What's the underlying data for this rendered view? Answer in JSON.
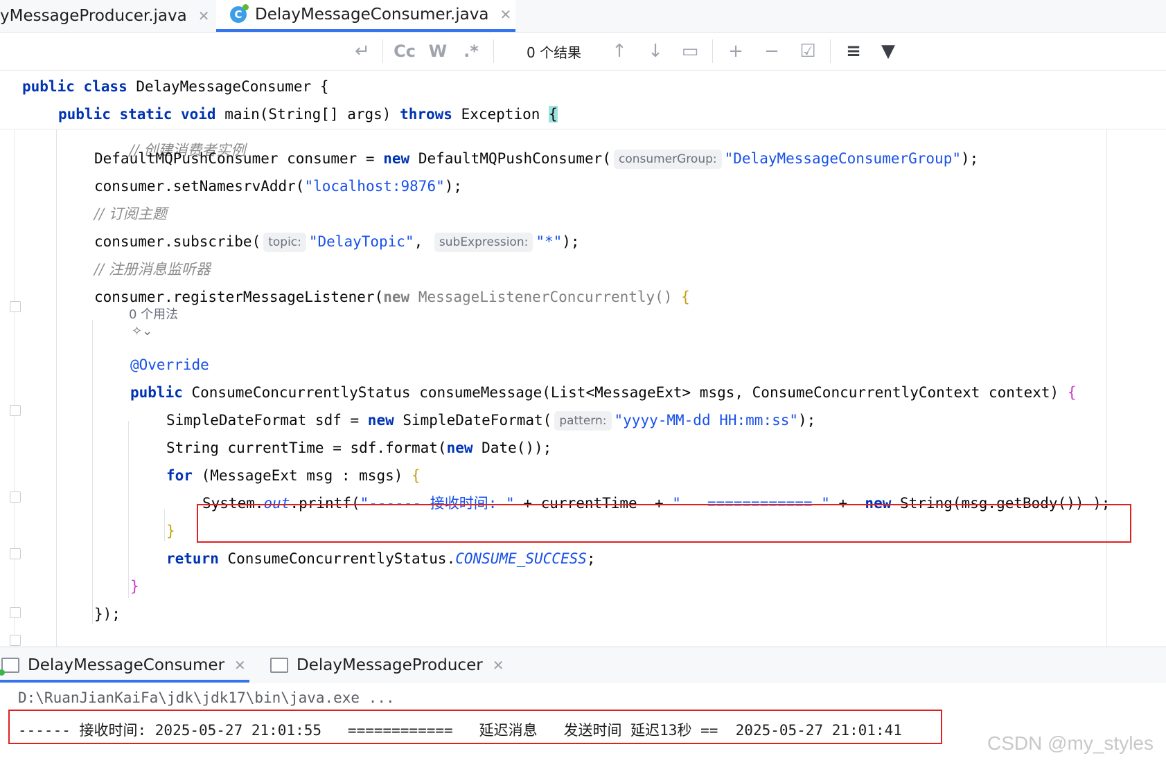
{
  "tabs": [
    {
      "label": "yMessageProducer.java"
    },
    {
      "label": "DelayMessageConsumer.java"
    }
  ],
  "find_toolbar": {
    "replace_icon": "↵",
    "match_case": "Cc",
    "words": "W",
    "regex": ".*",
    "result": "0 个结果",
    "prev_icon": "↑",
    "next_icon": "↓",
    "select_all_icon": "▭",
    "add_occurrence_icon": "+",
    "remove_occurrence_icon": "−",
    "select_occurrences_icon": "☑",
    "filter_options_icon": "≡",
    "filter_icon": "▼"
  },
  "code": {
    "l1_kw": "public class",
    "l1_name": " DelayMessageConsumer ",
    "l1_brace": "{",
    "l2_kw1": "public static void",
    "l2_a": " main(String[] args) ",
    "l2_kw2": "throws",
    "l2_b": " Exception ",
    "l2_brace": "{",
    "l3_comment": "// 创建消费者实例",
    "l4_a": "DefaultMQPushConsumer consumer = ",
    "l4_new": "new",
    "l4_b": " DefaultMQPushConsumer(",
    "l4_hint": "consumerGroup:",
    "l4_str": "\"DelayMessageConsumerGroup\"",
    "l4_end": ");",
    "l5_a": "consumer.setNamesrvAddr(",
    "l5_str": "\"localhost:9876\"",
    "l5_end": ");",
    "l6_comment": "// 订阅主题",
    "l7_a": "consumer.subscribe(",
    "l7_hint1": "topic:",
    "l7_str1": "\"DelayTopic\"",
    "l7_comma": ", ",
    "l7_hint2": "subExpression:",
    "l7_str2": "\"*\"",
    "l7_end": ");",
    "l8_comment": "// 注册消息监听器",
    "l9_a": "consumer.registerMessageListener(",
    "l9_new": "new",
    "l9_b": " MessageListenerConcurrently() ",
    "l9_brace": "{",
    "usage": "0 个用法",
    "override": "@Override",
    "l11_kw": "public",
    "l11_a": " ConsumeConcurrentlyStatus consumeMessage(List<MessageExt> msgs, ConsumeConcurrentlyContext context) ",
    "l11_brace": "{",
    "l12_a": "SimpleDateFormat sdf = ",
    "l12_new": "new",
    "l12_b": " SimpleDateFormat(",
    "l12_hint": "pattern:",
    "l12_str": "\"yyyy-MM-dd HH:mm:ss\"",
    "l12_end": ");",
    "l13_a": "String currentTime = sdf.format(",
    "l13_new": "new",
    "l13_b": " Date());",
    "l14_kw": "for",
    "l14_a": " (MessageExt msg : msgs) ",
    "l14_brace": "{",
    "l15_a": "System.",
    "l15_out": "out",
    "l15_b": ".printf(",
    "l15_str1": "\"------ 接收时间: \"",
    "l15_c": " + currentTime  + ",
    "l15_str2": "\"   ============ \"",
    "l15_d": " +  ",
    "l15_new": "new",
    "l15_e": " String(msg.getBody()) );",
    "l16_brace": "}",
    "l17_kw": "return",
    "l17_a": " ConsumeConcurrentlyStatus.",
    "l17_const": "CONSUME_SUCCESS",
    "l17_end": ";",
    "l18_brace": "}",
    "l19": "});"
  },
  "run_tabs": [
    {
      "label": "DelayMessageConsumer"
    },
    {
      "label": "DelayMessageProducer"
    }
  ],
  "console": {
    "line1": "D:\\RuanJianKaiFa\\jdk\\jdk17\\bin\\java.exe ...",
    "line2": "------ 接收时间: 2025-05-27 21:01:55   ============   延迟消息   发送时间 延迟13秒 ==  2025-05-27 21:01:41"
  },
  "watermark": "CSDN @my_styles"
}
